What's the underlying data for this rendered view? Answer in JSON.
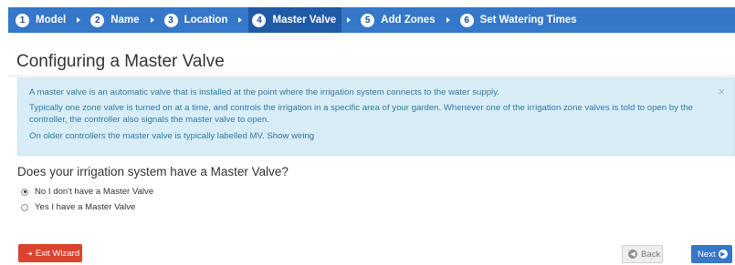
{
  "wizard_steps": [
    {
      "num": "1",
      "label": "Model"
    },
    {
      "num": "2",
      "label": "Name"
    },
    {
      "num": "3",
      "label": "Location"
    },
    {
      "num": "4",
      "label": "Master Valve",
      "active": true
    },
    {
      "num": "5",
      "label": "Add Zones"
    },
    {
      "num": "6",
      "label": "Set Watering Times"
    }
  ],
  "page": {
    "title": "Configuring a Master Valve"
  },
  "info_box": {
    "line1": "A master valve is an automatic valve that is installed at the point where the irrigation system connects to the water supply.",
    "line2": "Typically one zone valve is turned on at a time, and controls the irrigation in a specific area of your garden. Whenever one of the irrigation zone valves is told to open by the controller, the controller also signals the master valve to open.",
    "line3_prefix": "On older controllers the master valve is typically labelled MV.",
    "line3_link": "Show wiring",
    "close_symbol": "×"
  },
  "question": {
    "text": "Does your irrigation system have a Master Valve?",
    "options": [
      {
        "label": "No I don't have a Master Valve",
        "selected": true
      },
      {
        "label": "Yes I have a Master Valve",
        "selected": false
      }
    ]
  },
  "buttons": {
    "exit": "Exit Wizard",
    "back": "Back",
    "next": "Next"
  },
  "colors": {
    "step_bar": "#3577c9",
    "step_active": "#1f5aa6",
    "info_bg": "#d9edf7",
    "exit_button": "#d9432f"
  }
}
